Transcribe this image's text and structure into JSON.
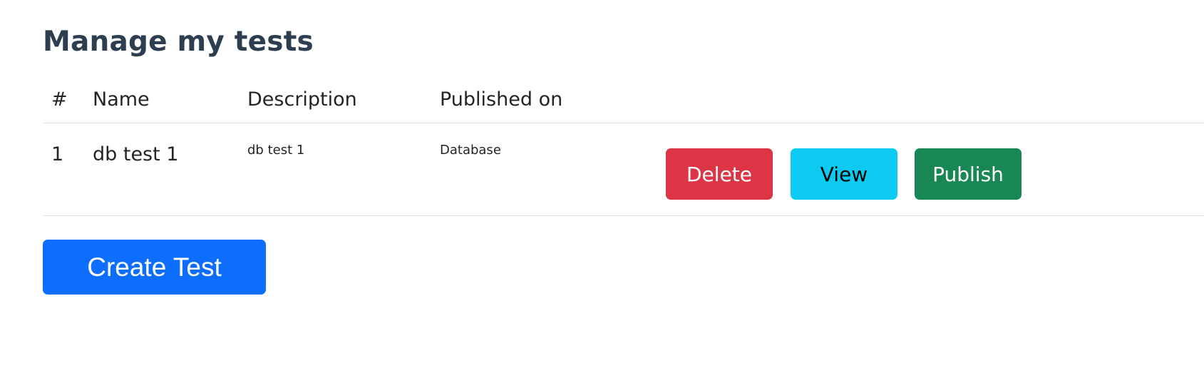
{
  "page": {
    "title": "Manage my tests"
  },
  "table": {
    "headers": {
      "num": "#",
      "name": "Name",
      "description": "Description",
      "published_on": "Published on"
    },
    "rows": [
      {
        "num": "1",
        "name": "db test 1",
        "description": "db test 1",
        "published_on": "Database",
        "actions": {
          "delete": "Delete",
          "view": "View",
          "publish": "Publish"
        }
      }
    ]
  },
  "actions": {
    "create_label": "Create Test"
  },
  "colors": {
    "danger": "#dc3545",
    "info": "#0dcaf0",
    "success": "#198754",
    "primary": "#0d6efd",
    "title": "#2c3e50"
  }
}
